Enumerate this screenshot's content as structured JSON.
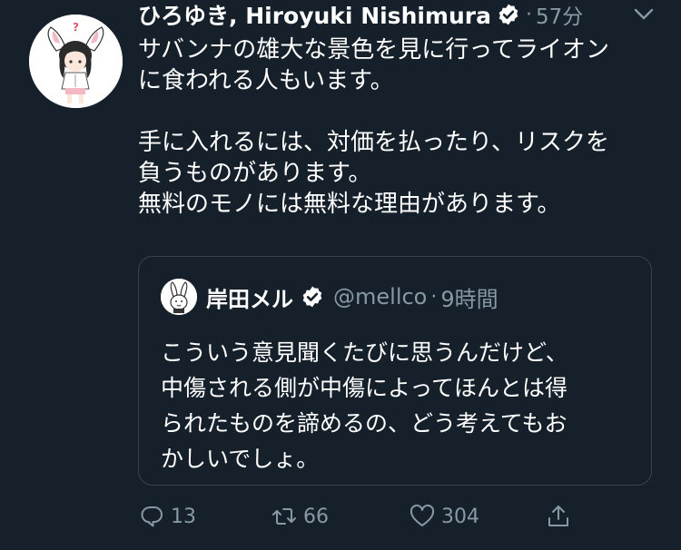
{
  "tweet": {
    "author_name": "ひろゆき, Hiroyuki Nishimura",
    "separator": "·",
    "time": "57分",
    "body_lines": [
      "サバンナの雄大な景色を見に行ってライオン",
      "に食われる人もいます。",
      "手に入れるには、対価を払ったり、リスクを",
      "負うものがあります。",
      "無料のモノには無料な理由があります。"
    ]
  },
  "quote": {
    "author_name": "岸田メル",
    "handle": "@mellco",
    "separator": "·",
    "time": "9時間",
    "body_lines": [
      "こういう意見聞くたびに思うんだけど、",
      "中傷される側が中傷によってほんとは得",
      "られたものを諦めるの、どう考えてもお",
      "かしいでしょ。"
    ]
  },
  "actions": {
    "reply_count": "13",
    "retweet_count": "66",
    "like_count": "304"
  },
  "icons": {
    "verified": "verified-badge-icon",
    "caret": "chevron-down-icon",
    "reply": "reply-icon",
    "retweet": "retweet-icon",
    "like": "heart-icon",
    "share": "share-icon"
  },
  "colors": {
    "background": "#15202b",
    "text_primary": "#ffffff",
    "text_secondary": "#8899a6",
    "border": "#38444d"
  }
}
